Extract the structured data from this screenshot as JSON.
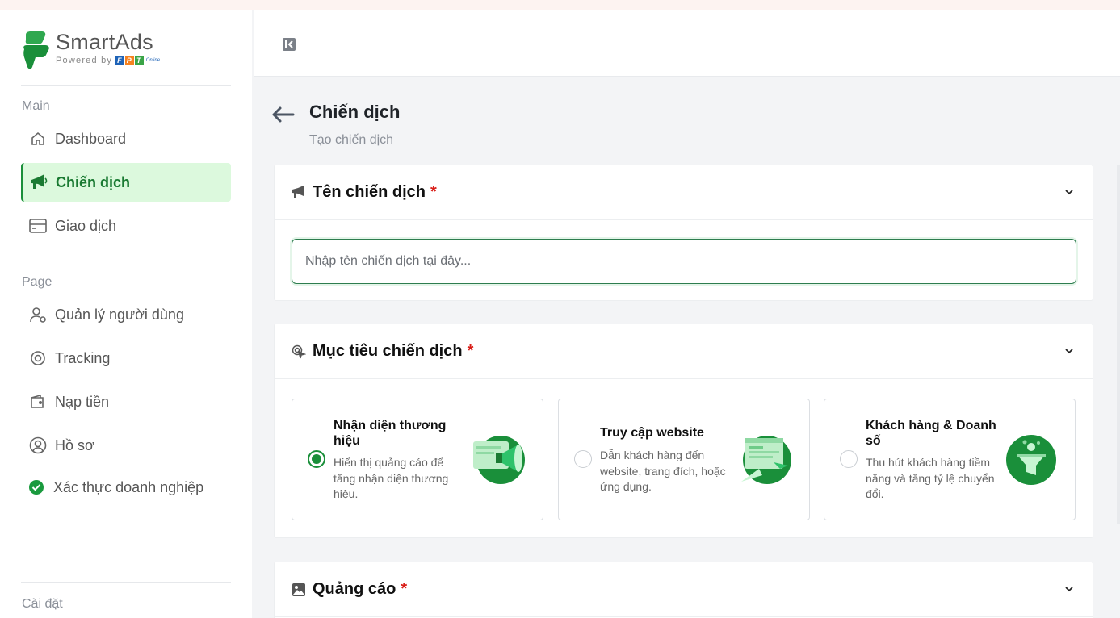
{
  "brand": {
    "name": "SmartAds",
    "powered_by": "Powered by",
    "partner_logo_text": "FPT Online",
    "color": "#1a8f3a"
  },
  "sidebar": {
    "section_main": "Main",
    "main_items": [
      {
        "label": "Dashboard",
        "icon": "home-icon"
      },
      {
        "label": "Chiến dịch",
        "icon": "megaphone-icon",
        "active": true
      },
      {
        "label": "Giao dịch",
        "icon": "card-icon"
      }
    ],
    "section_page": "Page",
    "page_items": [
      {
        "label": "Quản lý người dùng",
        "icon": "user-gear-icon"
      },
      {
        "label": "Tracking",
        "icon": "target-icon"
      },
      {
        "label": "Nạp tiền",
        "icon": "wallet-icon"
      },
      {
        "label": "Hồ sơ",
        "icon": "profile-icon"
      },
      {
        "label": "Xác thực doanh nghiệp",
        "icon": "verified-icon"
      }
    ],
    "section_settings": "Cài đặt"
  },
  "page": {
    "title": "Chiến dịch",
    "subtitle": "Tạo chiến dịch"
  },
  "sections": {
    "name": {
      "title": "Tên chiến dịch",
      "required_mark": "*",
      "input_placeholder": "Nhập tên chiến dịch tại đây...",
      "input_value": ""
    },
    "goal": {
      "title": "Mục tiêu chiến dịch",
      "required_mark": "*",
      "options": [
        {
          "title": "Nhận diện thương hiệu",
          "desc": "Hiển thị quảng cáo để tăng nhận diện thương hiệu.",
          "selected": true
        },
        {
          "title": "Truy cập website",
          "desc": "Dẫn khách hàng đến website, trang đích, hoặc ứng dụng.",
          "selected": false
        },
        {
          "title": "Khách hàng & Doanh số",
          "desc": "Thu hút khách hàng tiềm năng và tăng tỷ lệ chuyển đổi.",
          "selected": false
        }
      ]
    },
    "ads": {
      "title": "Quảng cáo",
      "required_mark": "*"
    }
  }
}
